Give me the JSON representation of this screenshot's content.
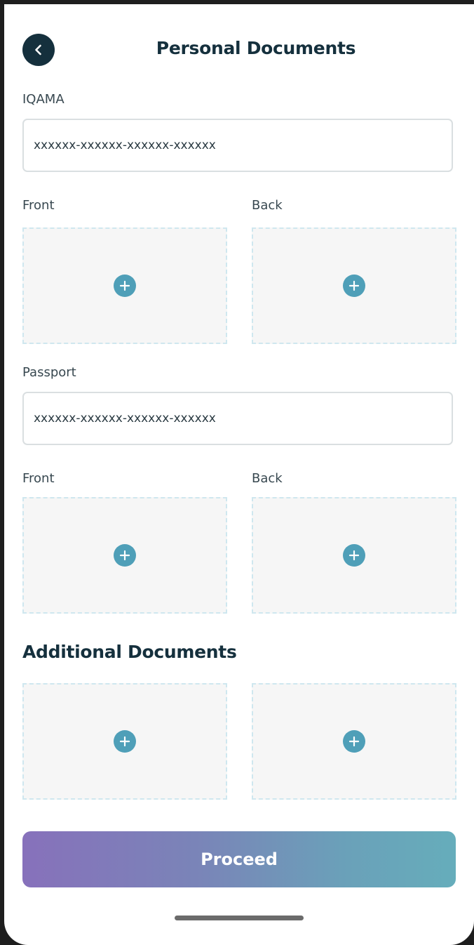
{
  "header": {
    "title": "Personal Documents",
    "back_icon": "chevron-left-icon"
  },
  "iqama": {
    "label": "IQAMA",
    "value": "xxxxxx-xxxxxx-xxxxxx-xxxxxx",
    "front_label": "Front",
    "back_label": "Back"
  },
  "passport": {
    "label": "Passport",
    "value": "xxxxxx-xxxxxx-xxxxxx-xxxxxx",
    "front_label": "Front",
    "back_label": "Back"
  },
  "additional": {
    "title": "Additional Documents"
  },
  "upload_icon": "plus-circle-icon",
  "proceed_label": "Proceed",
  "colors": {
    "primary_dark": "#15303d",
    "accent": "#4f9fb8",
    "gradient_start": "#8771bb",
    "gradient_end": "#66adbb"
  }
}
